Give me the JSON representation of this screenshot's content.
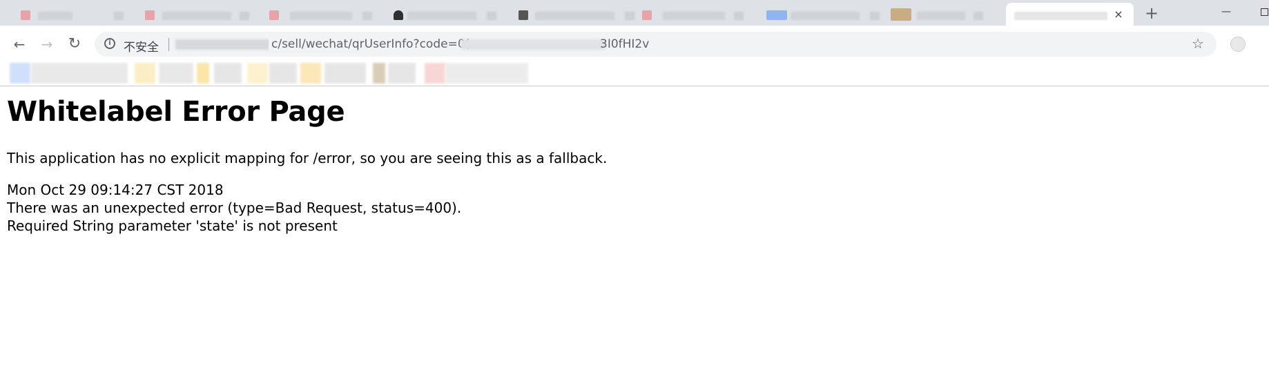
{
  "browser": {
    "tabs": [
      {
        "favicon_color": "#e8a3a6"
      },
      {
        "favicon_color": "#e8a3a6"
      },
      {
        "favicon_color": "#e8a3a6"
      },
      {
        "favicon_color": "#2f2f2f"
      },
      {
        "favicon_color": "#555555"
      },
      {
        "favicon_color": "#e8a3a6"
      },
      {
        "favicon_color": "#8fb4f0"
      },
      {
        "favicon_color": "#c9ab84"
      }
    ],
    "active_tab_close": "×",
    "new_tab": "+",
    "minimize": "—",
    "nav": {
      "back": "←",
      "forward": "→",
      "reload": "↻"
    },
    "address_bar": {
      "security_label": "不安全",
      "url_visible_middle": "c/sell/wechat/qrUserInfo?code=0(",
      "url_visible_end": "3I0fHI2v"
    },
    "bookmark_colors": [
      "#cfe0fb",
      "#e4e4e4",
      "#fbeec4",
      "#fbe5a8",
      "#fdf2cf",
      "#fbe7b8",
      "#d9cdb8",
      "#f8d6d6"
    ]
  },
  "page": {
    "title": "Whitelabel Error Page",
    "description": "This application has no explicit mapping for /error, so you are seeing this as a fallback.",
    "timestamp": "Mon Oct 29 09:14:27 CST 2018",
    "error_line": "There was an unexpected error (type=Bad Request, status=400).",
    "detail_line": "Required String parameter 'state' is not present"
  }
}
